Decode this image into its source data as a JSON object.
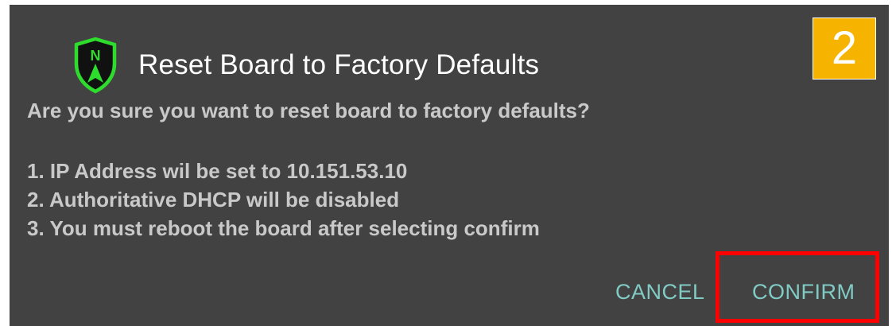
{
  "dialog": {
    "title": "Reset Board to Factory Defaults",
    "logo_icon": "compass-shield-icon",
    "logo_letter": "N",
    "question": "Are you sure you want to reset board to factory defaults?",
    "items": [
      "1. IP Address wil be set to 10.151.53.10",
      "2. Authoritative DHCP will be disabled",
      "3. You must reboot the board after selecting confirm"
    ],
    "cancel_label": "CANCEL",
    "confirm_label": "CONFIRM"
  },
  "annotation": {
    "step_number": "2",
    "badge_color": "#f6b400",
    "highlight_color": "#ff0000"
  },
  "colors": {
    "dialog_bg": "#424242",
    "button_text": "#80cbc4",
    "logo_green": "#2edc2e"
  }
}
